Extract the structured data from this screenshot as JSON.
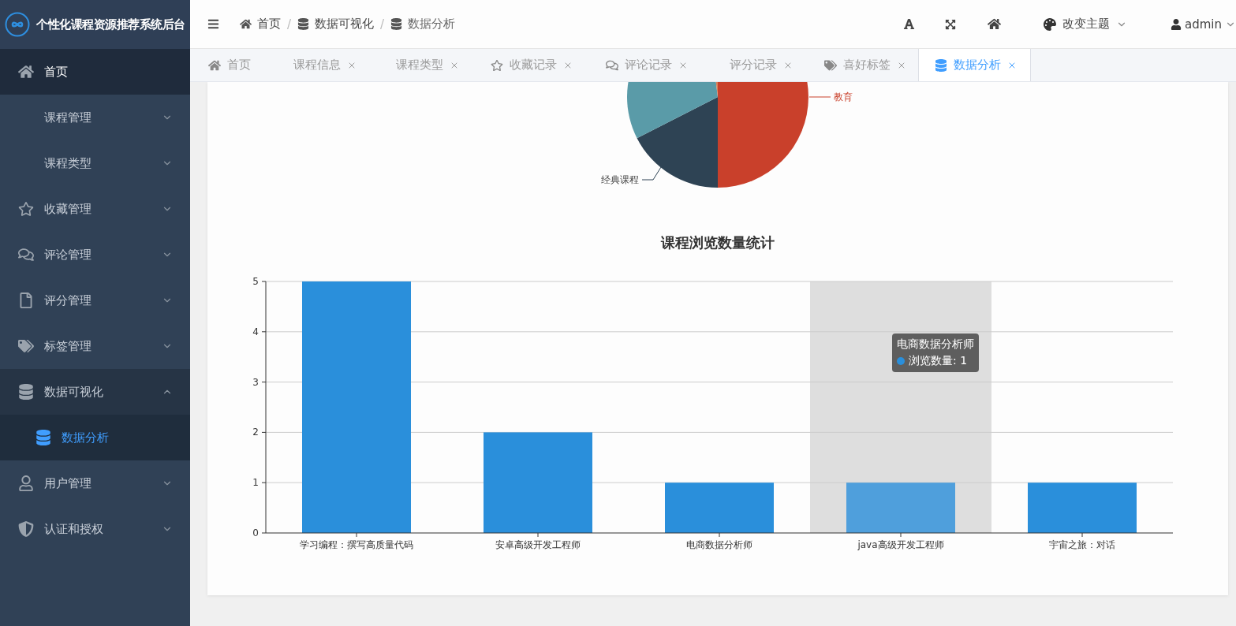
{
  "sidebar": {
    "title": "个性化课程资源推荐系统后台",
    "items": [
      {
        "label": "首页",
        "selected": true,
        "expandable": false,
        "expanded": false
      },
      {
        "label": "课程管理",
        "selected": false,
        "expandable": true,
        "expanded": false
      },
      {
        "label": "课程类型",
        "selected": false,
        "expandable": true,
        "expanded": false
      },
      {
        "label": "收藏管理",
        "selected": false,
        "expandable": true,
        "expanded": false
      },
      {
        "label": "评论管理",
        "selected": false,
        "expandable": true,
        "expanded": false
      },
      {
        "label": "评分管理",
        "selected": false,
        "expandable": true,
        "expanded": false
      },
      {
        "label": "标签管理",
        "selected": false,
        "expandable": true,
        "expanded": false
      },
      {
        "label": "数据可视化",
        "selected": false,
        "expandable": true,
        "expanded": true,
        "children": [
          {
            "label": "数据分析",
            "selected": true
          }
        ]
      },
      {
        "label": "用户管理",
        "selected": false,
        "expandable": true,
        "expanded": false
      },
      {
        "label": "认证和授权",
        "selected": false,
        "expandable": true,
        "expanded": false
      }
    ]
  },
  "header": {
    "breadcrumb": [
      "首页",
      "数据可视化",
      "数据分析"
    ],
    "separator": "/",
    "theme_label": "改变主题",
    "user": "admin"
  },
  "tabs": [
    {
      "label": "首页",
      "selected": false,
      "closable": false
    },
    {
      "label": "课程信息",
      "selected": false,
      "closable": true
    },
    {
      "label": "课程类型",
      "selected": false,
      "closable": true
    },
    {
      "label": "收藏记录",
      "selected": false,
      "closable": true
    },
    {
      "label": "评论记录",
      "selected": false,
      "closable": true
    },
    {
      "label": "评分记录",
      "selected": false,
      "closable": true
    },
    {
      "label": "喜好标签",
      "selected": false,
      "closable": true
    },
    {
      "label": "数据分析",
      "selected": true,
      "closable": true
    }
  ],
  "pie": {
    "slices": [
      {
        "label": "教育",
        "color": "#c9402b"
      },
      {
        "label": "经典课程",
        "color": "#2e4354"
      },
      {
        "color": "#5a9ba8"
      },
      {
        "color": "#d9825b"
      }
    ]
  },
  "bar_chart": {
    "chart_data": {
      "type": "bar",
      "title": "课程浏览数量统计",
      "categories": [
        "学习编程：撰写高质量代码",
        "安卓高级开发工程师",
        "电商数据分析师",
        "java高级开发工程师",
        "宇宙之旅：对话"
      ],
      "series": [
        {
          "name": "浏览数量",
          "color": "#2a8fdb",
          "values": [
            5,
            2,
            1,
            1,
            1
          ]
        }
      ],
      "ylim": [
        0,
        5
      ],
      "yticks": [
        0,
        1,
        2,
        3,
        4,
        5
      ],
      "grid": true
    },
    "bands": [
      {
        "selected": false
      },
      {
        "selected": false
      },
      {
        "selected": false
      },
      {
        "selected": true
      },
      {
        "selected": false
      }
    ],
    "tooltip": {
      "title": "电商数据分析师",
      "separator": ":",
      "value": "1"
    }
  }
}
